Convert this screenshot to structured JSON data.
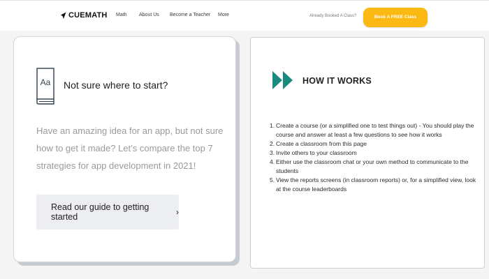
{
  "nav": {
    "logo_text": "CUEMATH",
    "links": [
      "Math",
      "About Us",
      "Become a Teacher",
      "More"
    ],
    "booked_text": "Already Booked A Class?",
    "cta_label": "Book A FREE Class",
    "cta_color": "#fdb913"
  },
  "left_card": {
    "icon": "book-aa-icon",
    "icon_text": "Aa",
    "title": "Not sure where to start?",
    "description": "Have an amazing idea for an app, but not sure how to get it made? Let’s compare the top 7 strategies for app development in 2021!",
    "button_label": "Read our guide to getting started",
    "button_chevron": "›"
  },
  "right_card": {
    "icon": "fast-forward-icon",
    "icon_color": "#1a8a80",
    "title": "HOW IT WORKS",
    "steps": [
      {
        "num": "1.",
        "text": "Create a course (or a simplified one to test things out) - You should play the course and answer at least a few questions to see how it works"
      },
      {
        "num": "2.",
        "text": "Create a classroom from this page"
      },
      {
        "num": "3.",
        "text": "Invite others to your classroom"
      },
      {
        "num": "4.",
        "text": "Either use the classroom chat or your own method to communicate to the students"
      },
      {
        "num": "5.",
        "text": "View the reports screens (in classroom reports) or, for a simplified view, look at the course leaderboards"
      }
    ]
  }
}
